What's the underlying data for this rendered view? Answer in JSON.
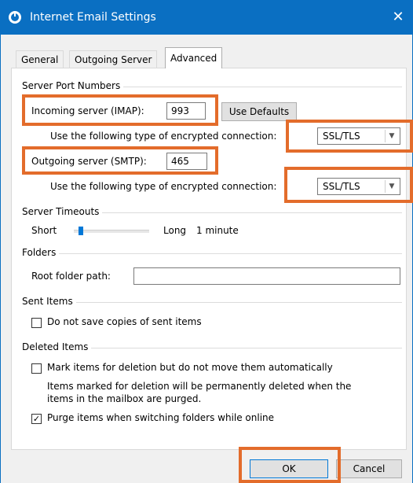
{
  "window": {
    "title": "Internet Email Settings",
    "close_glyph": "✕"
  },
  "tabs": [
    {
      "label": "General"
    },
    {
      "label": "Outgoing Server"
    },
    {
      "label": "Advanced"
    }
  ],
  "server_ports": {
    "group_label": "Server Port Numbers",
    "incoming_label": "Incoming server (IMAP):",
    "incoming_value": "993",
    "use_defaults_label": "Use Defaults",
    "encryption_label_1": "Use the following type of encrypted connection:",
    "encryption_value_1": "SSL/TLS",
    "outgoing_label": "Outgoing server (SMTP):",
    "outgoing_value": "465",
    "encryption_label_2": "Use the following type of encrypted connection:",
    "encryption_value_2": "SSL/TLS"
  },
  "timeouts": {
    "group_label": "Server Timeouts",
    "short_label": "Short",
    "long_label": "Long",
    "value_text": "1 minute",
    "slider_level_fraction": 0.05
  },
  "folders": {
    "group_label": "Folders",
    "root_label": "Root folder path:",
    "root_value": ""
  },
  "sent_items": {
    "group_label": "Sent Items",
    "no_copies_label": "Do not save copies of sent items",
    "no_copies_checked": false
  },
  "deleted_items": {
    "group_label": "Deleted Items",
    "mark_label": "Mark items for deletion but do not move them automatically",
    "mark_checked": false,
    "note_line1": "Items marked for deletion will be permanently deleted when the",
    "note_line2": "items in the mailbox are purged.",
    "purge_label": "Purge items when switching folders while online",
    "purge_checked": true
  },
  "buttons": {
    "ok": "OK",
    "cancel": "Cancel"
  },
  "highlight_color": "#e36c2b",
  "title_bar_color": "#0a6fc2"
}
